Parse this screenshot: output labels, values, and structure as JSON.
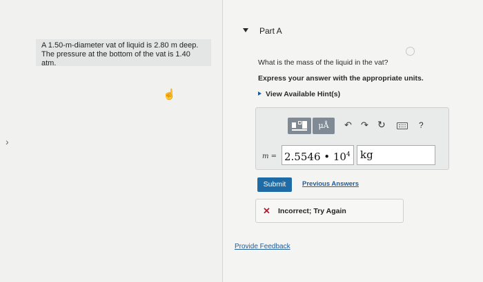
{
  "problem": {
    "line1": "A 1.50-m-diameter vat of liquid is 2.80 m deep.",
    "line2": "The pressure at the bottom of the vat is 1.40 atm."
  },
  "part": {
    "title": "Part A"
  },
  "question": {
    "text": "What is the mass of the liquid in the vat?",
    "instruction": "Express your answer with the appropriate units.",
    "hints_label": "View Available Hint(s)"
  },
  "toolbar": {
    "units_label": "μÅ",
    "undo_icon": "↶",
    "redo_icon": "↷",
    "reset_icon": "↻",
    "help_label": "?"
  },
  "answer": {
    "variable": "m",
    "equals": " = ",
    "mantissa": "2.5546",
    "times": " • ",
    "base": "10",
    "exponent": "4",
    "units": "kg"
  },
  "actions": {
    "submit_label": "Submit",
    "previous_answers_label": "Previous Answers"
  },
  "feedback": {
    "icon": "✕",
    "text": "Incorrect; Try Again"
  },
  "footer": {
    "provide_feedback_label": "Provide Feedback"
  },
  "colors": {
    "accent": "#1f6ba5",
    "link": "#1f5a99",
    "error": "#c8102e"
  }
}
